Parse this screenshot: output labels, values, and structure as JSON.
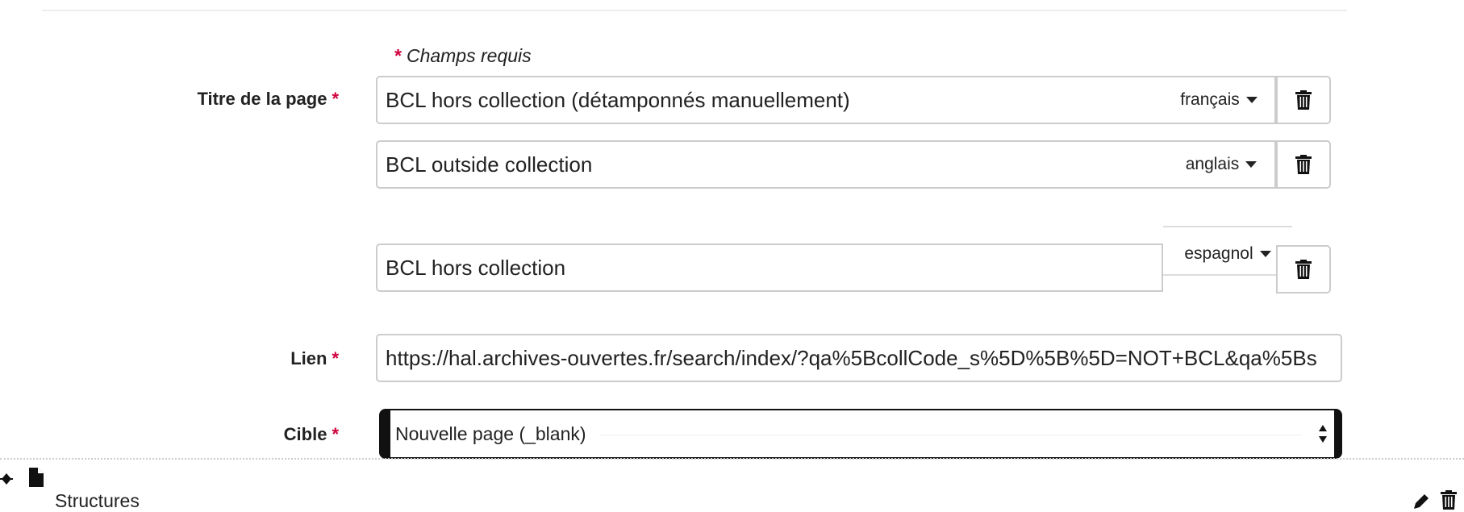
{
  "form": {
    "required_note": "Champs requis",
    "required_star": "*",
    "title_label": "Titre de la page",
    "link_label": "Lien",
    "target_label": "Cible",
    "titles": [
      {
        "value": "BCL hors collection (détamponnés manuellement)",
        "lang": "français"
      },
      {
        "value": "BCL outside collection",
        "lang": "anglais"
      },
      {
        "value": "BCL hors collection",
        "lang": "espagnol"
      }
    ],
    "link_value": "https://hal.archives-ouvertes.fr/search/index/?qa%5BcollCode_s%5D%5B%5D=NOT+BCL&qa%5Bs",
    "target_value": "Nouvelle page (_blank)"
  },
  "tree_item": {
    "label": "Structures",
    "icons": [
      "tree-expand-icon",
      "file-icon",
      "pencil-icon",
      "trash-icon"
    ]
  },
  "colors": {
    "required": "#d1003c",
    "border": "#cccccc"
  }
}
